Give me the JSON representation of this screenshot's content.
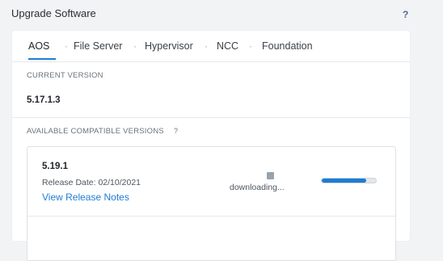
{
  "header": {
    "title": "Upgrade Software",
    "help_icon": "question-mark-icon",
    "help_glyph": "?"
  },
  "tabs": [
    {
      "label": "AOS",
      "active": true
    },
    {
      "label": "File Server",
      "active": false
    },
    {
      "label": "Hypervisor",
      "active": false
    },
    {
      "label": "NCC",
      "active": false
    },
    {
      "label": "Foundation",
      "active": false
    }
  ],
  "tab_separator": "·",
  "current": {
    "label": "CURRENT VERSION",
    "version": "5.17.1.3"
  },
  "available": {
    "label": "AVAILABLE COMPATIBLE VERSIONS",
    "help_glyph": "?",
    "items": [
      {
        "version": "5.19.1",
        "release_date": "Release Date: 02/10/2021",
        "release_notes_link": "View Release Notes",
        "status_icon": "download-status-icon",
        "status_text": "downloading...",
        "progress_fraction": 0.82
      }
    ]
  },
  "colors": {
    "accent": "#1c7cd6",
    "background": "#f2f3f5",
    "card": "#ffffff"
  }
}
